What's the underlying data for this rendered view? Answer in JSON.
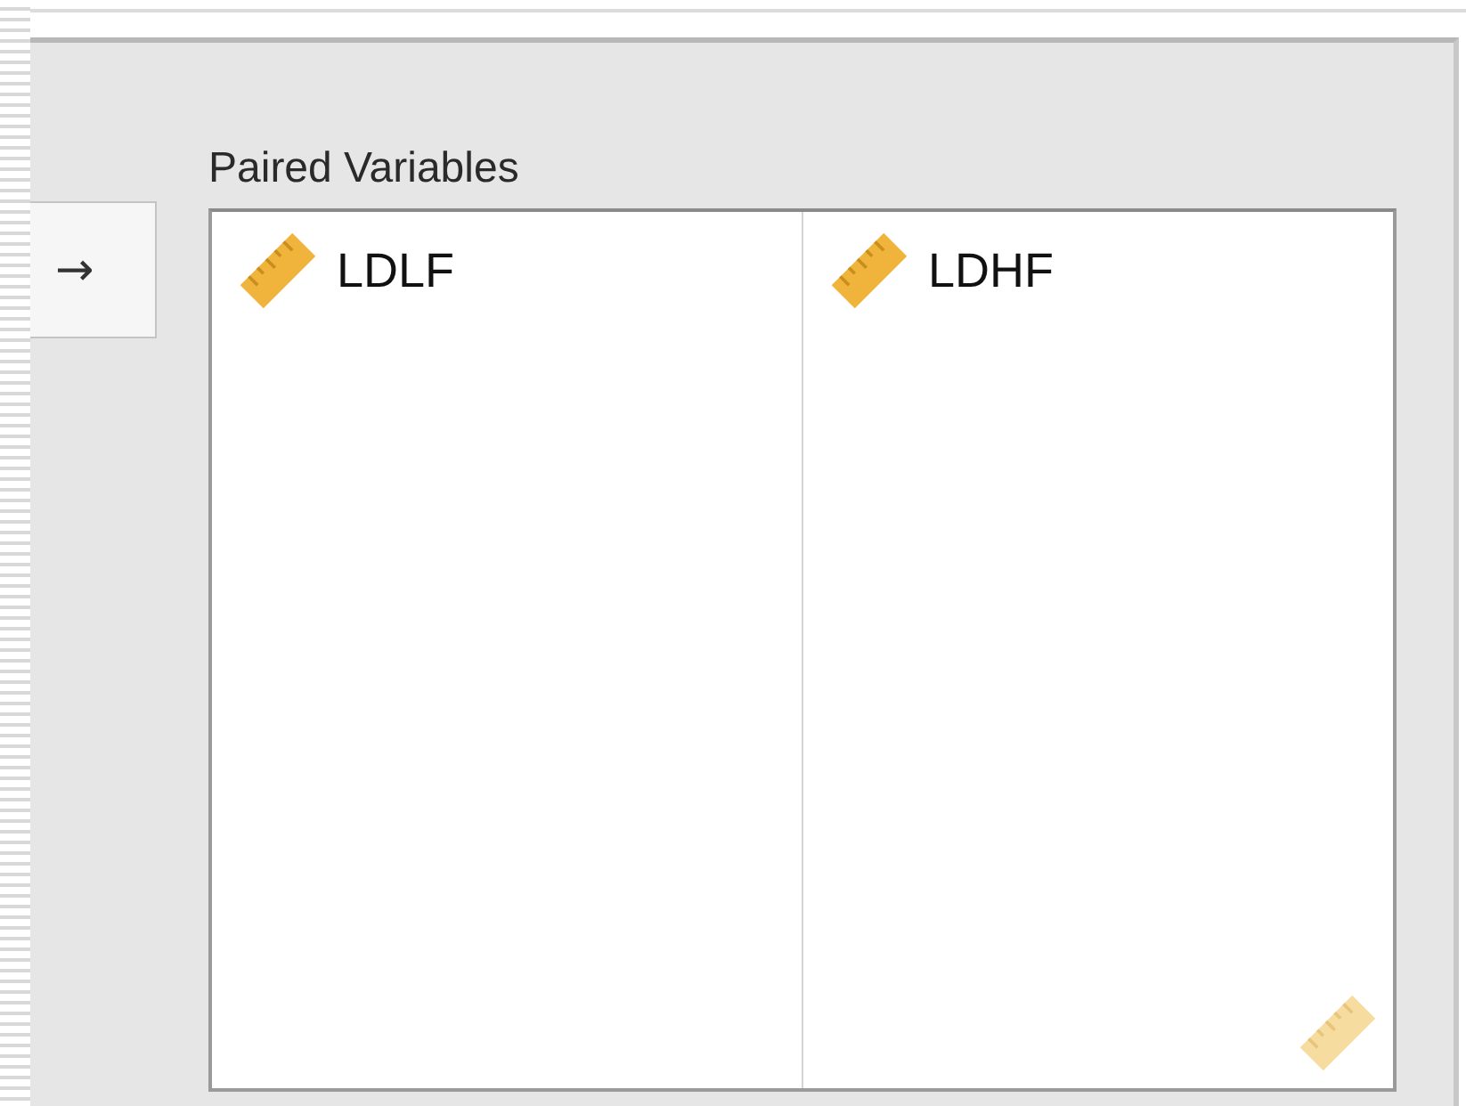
{
  "move_button": {
    "label": "→"
  },
  "paired_variables": {
    "label": "Paired Variables",
    "columns": [
      {
        "variable": {
          "name": "LDLF",
          "kind": "scale"
        }
      },
      {
        "variable": {
          "name": "LDHF",
          "kind": "scale"
        }
      }
    ],
    "drop_hint": {
      "kind": "scale"
    }
  }
}
